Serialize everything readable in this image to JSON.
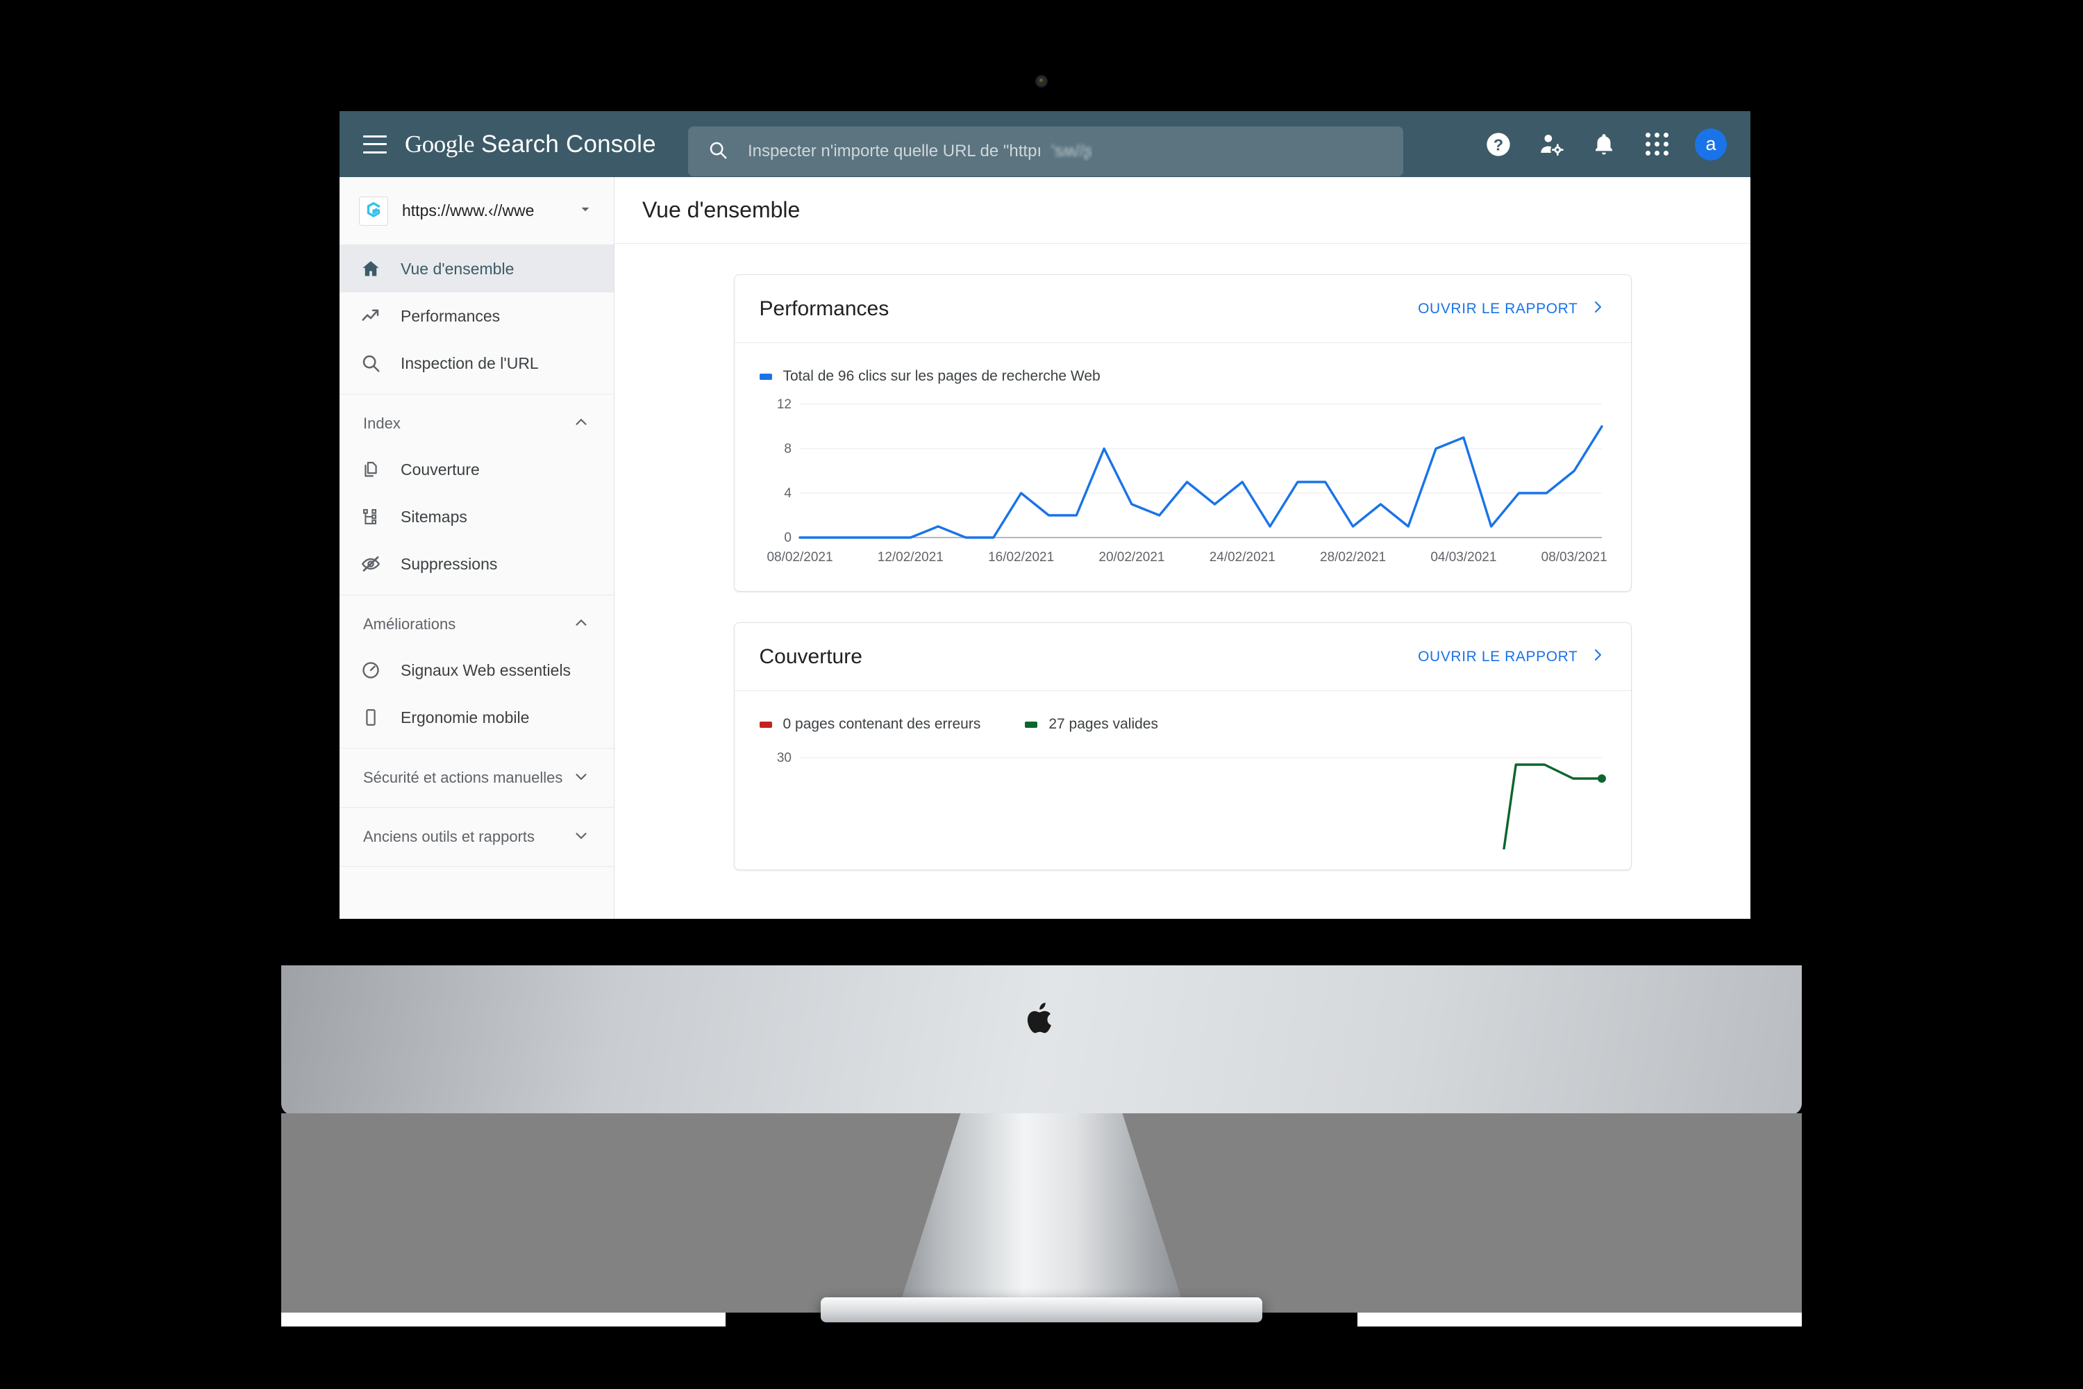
{
  "topbar": {
    "menu_icon": "hamburger-menu-icon",
    "brand_google": "Google",
    "brand_product": "Search Console",
    "search_icon": "search-icon",
    "search_placeholder": "Inspecter n'importe quelle URL de \"httpı",
    "search_placeholder_blurred": "ʹsʍ//ʂ",
    "help_icon": "help-circle-icon",
    "account_settings_icon": "user-settings-icon",
    "notifications_icon": "bell-icon",
    "apps_icon": "apps-grid-icon",
    "avatar_letter": "a"
  },
  "property_selector": {
    "favicon": "site-favicon-icon",
    "url_visible": "https://www.‹//wwe",
    "url_blurred": "         ",
    "dropdown_icon": "chevron-down-icon"
  },
  "sidebar": {
    "primary": [
      {
        "label": "Vue d'ensemble",
        "icon": "home-icon",
        "active": true
      },
      {
        "label": "Performances",
        "icon": "trending-up-icon",
        "active": false
      },
      {
        "label": "Inspection de l'URL",
        "icon": "search-icon",
        "active": false
      }
    ],
    "sections": [
      {
        "title": "Index",
        "expanded": true,
        "toggle_icon": "chevron-up-icon",
        "items": [
          {
            "label": "Couverture",
            "icon": "copy-pages-icon"
          },
          {
            "label": "Sitemaps",
            "icon": "sitemap-tree-icon"
          },
          {
            "label": "Suppressions",
            "icon": "eye-off-icon"
          }
        ]
      },
      {
        "title": "Améliorations",
        "expanded": true,
        "toggle_icon": "chevron-up-icon",
        "items": [
          {
            "label": "Signaux Web essentiels",
            "icon": "speedometer-icon"
          },
          {
            "label": "Ergonomie mobile",
            "icon": "mobile-phone-icon"
          }
        ]
      }
    ],
    "collapsed_sections": [
      {
        "title": "Sécurité et actions manuelles",
        "toggle_icon": "chevron-down-icon"
      },
      {
        "title": "Anciens outils et rapports",
        "toggle_icon": "chevron-down-icon"
      }
    ]
  },
  "page": {
    "title": "Vue d'ensemble"
  },
  "cards": {
    "performances": {
      "title": "Performances",
      "open_report_label": "OUVRIR LE RAPPORT",
      "open_report_icon": "chevron-right-icon",
      "legend": [
        {
          "label": "Total de 96 clics sur les pages de recherche Web",
          "color": "#1a73e8"
        }
      ]
    },
    "couverture": {
      "title": "Couverture",
      "open_report_label": "OUVRIR LE RAPPORT",
      "open_report_icon": "chevron-right-icon",
      "legend": [
        {
          "label": "0 pages contenant des erreurs",
          "color": "#c5221f"
        },
        {
          "label": "27 pages valides",
          "color": "#0d652d"
        }
      ]
    }
  },
  "chart_data": [
    {
      "id": "performances-chart",
      "type": "line",
      "title": "Total de 96 clics sur les pages de recherche Web",
      "xlabel": "",
      "ylabel": "",
      "ylim": [
        0,
        12
      ],
      "yticks": [
        0,
        4,
        8,
        12
      ],
      "grid": true,
      "legend_position": "top-left",
      "line_color": "#1a73e8",
      "x": [
        "08/02/2021",
        "09/02/2021",
        "10/02/2021",
        "11/02/2021",
        "12/02/2021",
        "13/02/2021",
        "14/02/2021",
        "15/02/2021",
        "16/02/2021",
        "17/02/2021",
        "18/02/2021",
        "19/02/2021",
        "20/02/2021",
        "21/02/2021",
        "22/02/2021",
        "23/02/2021",
        "24/02/2021",
        "25/02/2021",
        "26/02/2021",
        "27/02/2021",
        "28/02/2021",
        "01/03/2021",
        "02/03/2021",
        "03/03/2021",
        "04/03/2021",
        "05/03/2021",
        "06/03/2021",
        "07/03/2021",
        "08/03/2021",
        "09/03/2021"
      ],
      "xtick_labels": [
        "08/02/2021",
        "12/02/2021",
        "16/02/2021",
        "20/02/2021",
        "24/02/2021",
        "28/02/2021",
        "04/03/2021",
        "08/03/2021"
      ],
      "xtick_indices": [
        0,
        4,
        8,
        12,
        16,
        20,
        24,
        28
      ],
      "values": [
        0,
        0,
        0,
        0,
        0,
        1,
        0,
        0,
        4,
        2,
        2,
        8,
        3,
        2,
        5,
        3,
        5,
        1,
        5,
        5,
        1,
        3,
        1,
        8,
        9,
        1,
        4,
        4,
        6,
        10
      ]
    },
    {
      "id": "couverture-chart",
      "type": "line",
      "title": "Couverture",
      "ylim": [
        0,
        30
      ],
      "yticks": [
        30
      ],
      "grid": true,
      "series": [
        {
          "name": "0 pages contenant des erreurs",
          "color": "#c5221f",
          "values": []
        },
        {
          "name": "27 pages valides",
          "color": "#0d652d",
          "values": [
            0,
            0,
            0,
            0,
            0,
            0,
            0,
            0,
            0,
            0,
            0,
            0,
            0,
            0,
            0,
            0,
            0,
            0,
            0,
            0,
            0,
            0,
            0,
            0,
            0,
            29,
            29,
            27,
            27
          ]
        }
      ]
    }
  ]
}
